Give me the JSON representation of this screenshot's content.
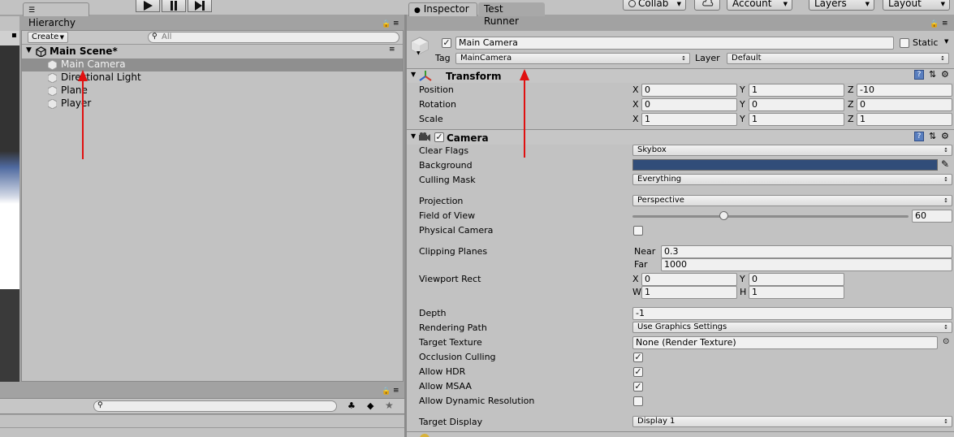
{
  "toolbar": {
    "collab": "Collab",
    "account": "Account",
    "layers": "Layers",
    "layout": "Layout"
  },
  "hierarchy": {
    "tab": "Hierarchy",
    "create": "Create",
    "search_placeholder": "All",
    "scene": "Main Scene*",
    "items": [
      "Main Camera",
      "Directional Light",
      "Plane",
      "Player"
    ]
  },
  "inspector": {
    "tabs": [
      "Inspector",
      "Test Runner"
    ],
    "object_name": "Main Camera",
    "static_label": "Static",
    "tag_label": "Tag",
    "tag_value": "MainCamera",
    "layer_label": "Layer",
    "layer_value": "Default",
    "transform": {
      "title": "Transform",
      "rows": [
        {
          "label": "Position",
          "x": "0",
          "y": "1",
          "z": "-10"
        },
        {
          "label": "Rotation",
          "x": "0",
          "y": "0",
          "z": "0"
        },
        {
          "label": "Scale",
          "x": "1",
          "y": "1",
          "z": "1"
        }
      ]
    },
    "camera": {
      "title": "Camera",
      "clear_flags_label": "Clear Flags",
      "clear_flags": "Skybox",
      "background_label": "Background",
      "background_color": "#314d79",
      "culling_mask_label": "Culling Mask",
      "culling_mask": "Everything",
      "projection_label": "Projection",
      "projection": "Perspective",
      "fov_label": "Field of View",
      "fov": "60",
      "fov_fraction": 0.33,
      "physical_label": "Physical Camera",
      "clipping_label": "Clipping Planes",
      "near_label": "Near",
      "near": "0.3",
      "far_label": "Far",
      "far": "1000",
      "viewport_label": "Viewport Rect",
      "vp_x": "0",
      "vp_y": "0",
      "vp_w": "1",
      "vp_h": "1",
      "depth_label": "Depth",
      "depth": "-1",
      "rendering_path_label": "Rendering Path",
      "rendering_path": "Use Graphics Settings",
      "target_texture_label": "Target Texture",
      "target_texture": "None (Render Texture)",
      "occlusion_label": "Occlusion Culling",
      "hdr_label": "Allow HDR",
      "msaa_label": "Allow MSAA",
      "dynres_label": "Allow Dynamic Resolution",
      "target_display_label": "Target Display",
      "target_display": "Display 1"
    }
  },
  "axes": {
    "x": "X",
    "y": "Y",
    "z": "Z",
    "w": "W",
    "h": "H"
  }
}
